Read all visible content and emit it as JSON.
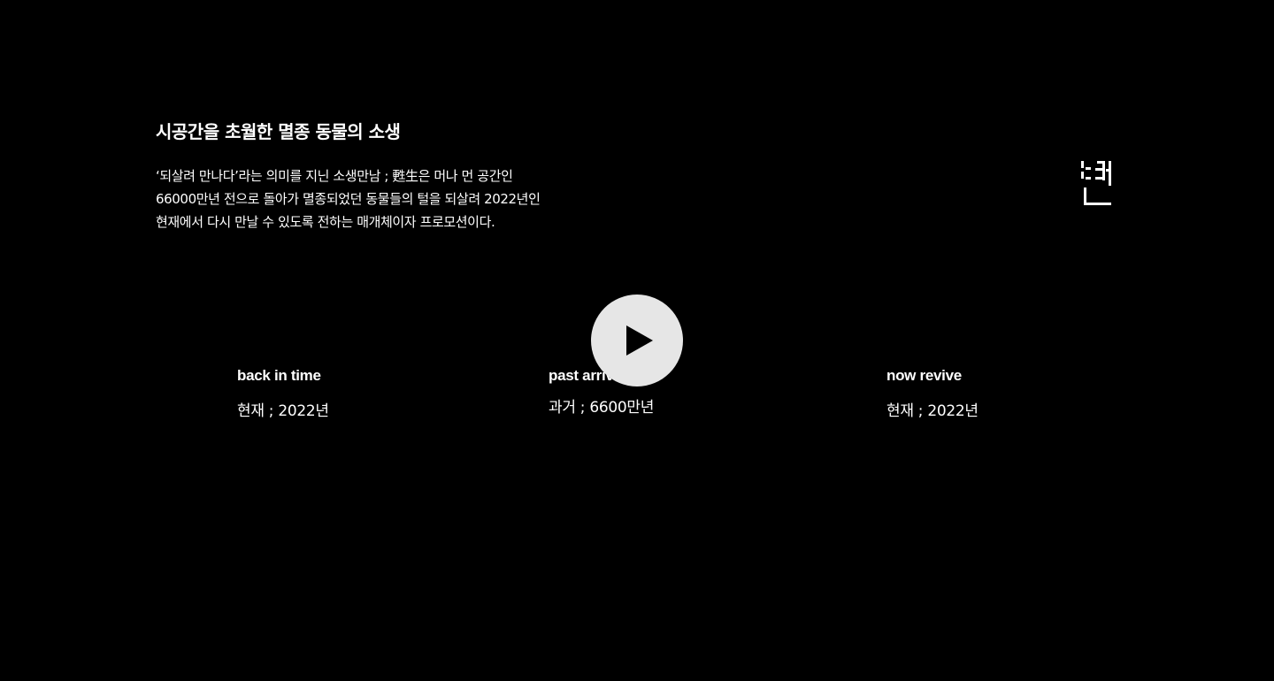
{
  "intro": {
    "title": "시공간을 초월한 멸종 동물의 소생",
    "description": "‘되살려 만나다’라는 의미를 지닌 소생만남 ; 甦生은 머나 먼 공간인 66000만년 전으로 돌아가 멸종되었던 동물들의 털을 되살려 2022년인 현재에서 다시 만날 수 있도록 전하는 매개체이자 프로모션이다."
  },
  "logo": {
    "icon": "logo-glyph-icon",
    "color": "#ffffff"
  },
  "video": {
    "play_icon": "play-icon",
    "button_color": "#e6e6e6"
  },
  "sections": [
    {
      "title": "back in time",
      "subtitle": "현재 ; 2022년"
    },
    {
      "title": "past arrival",
      "subtitle": "과거 ; 6600만년"
    },
    {
      "title": "now revive",
      "subtitle": "현재 ; 2022년"
    }
  ],
  "colors": {
    "background": "#000000",
    "text": "#ffffff"
  }
}
